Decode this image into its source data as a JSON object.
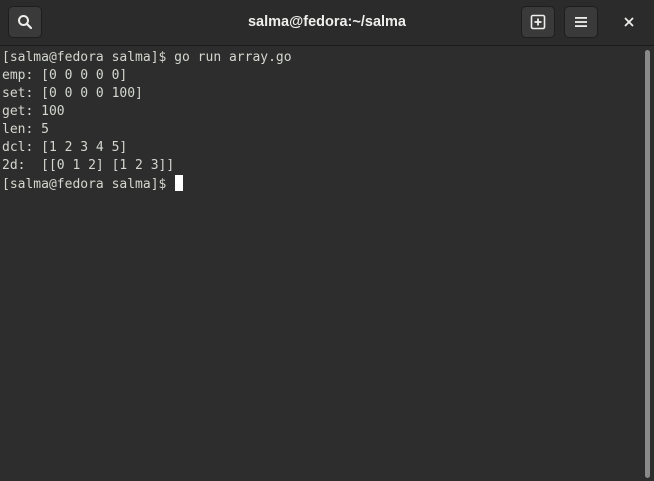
{
  "window": {
    "title": "salma@fedora:~/salma"
  },
  "header": {
    "search_icon": "search-icon",
    "new_tab_icon": "new-tab-icon",
    "menu_icon": "hamburger-menu-icon",
    "close_icon": "close-icon"
  },
  "terminal": {
    "lines": [
      "[salma@fedora salma]$ go run array.go",
      "emp: [0 0 0 0 0]",
      "set: [0 0 0 0 100]",
      "get: 100",
      "len: 5",
      "dcl: [1 2 3 4 5]",
      "2d:  [[0 1 2] [1 2 3]]"
    ],
    "prompt": "[salma@fedora salma]$ "
  },
  "colors": {
    "background": "#2d2d2d",
    "text": "#d3d7cf",
    "cursor": "#ffffff"
  }
}
